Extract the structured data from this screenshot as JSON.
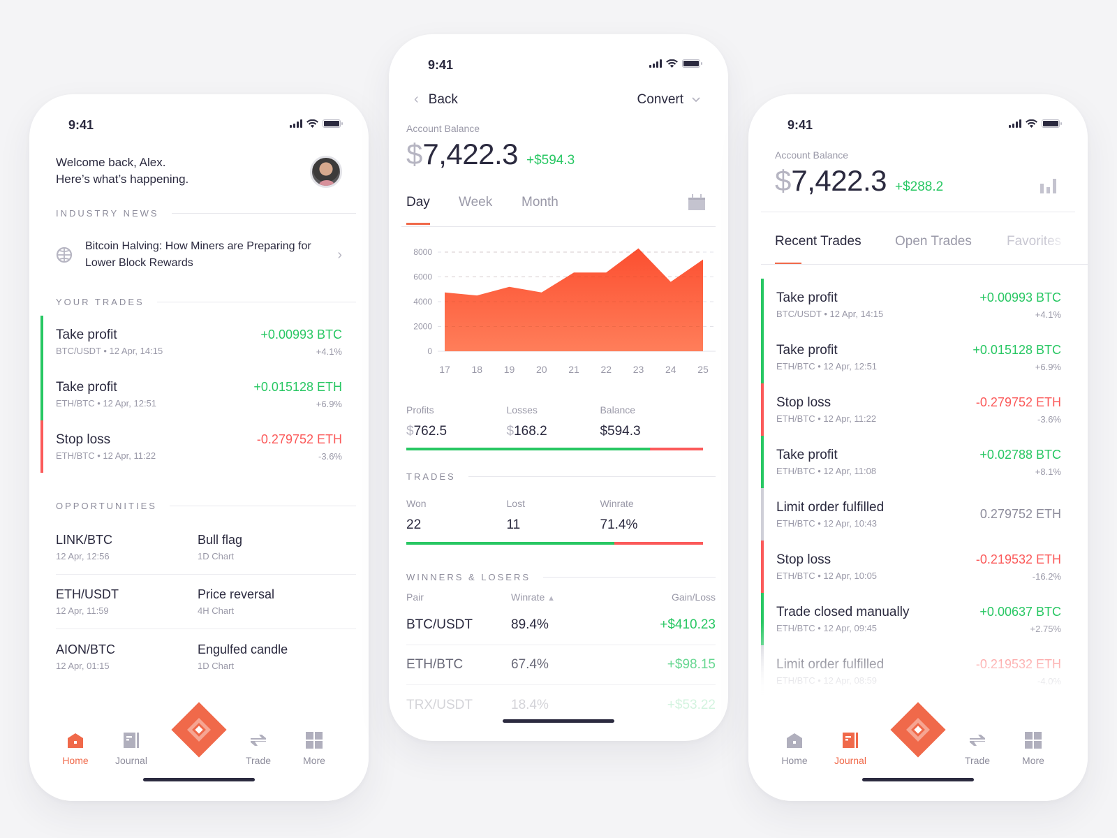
{
  "colors": {
    "accent": "#f0694a",
    "green": "#28c763",
    "red": "#fb5a5a",
    "neutral": "#cfcfd8",
    "text": "#2b2a3f",
    "muted": "#9a99a8"
  },
  "status_bar": {
    "time": "9:41"
  },
  "home": {
    "greeting_line1": "Welcome back, Alex.",
    "greeting_line2": "Here’s what’s happening.",
    "avatar_icon": "user-avatar",
    "industry_news_label": "INDUSTRY NEWS",
    "news": {
      "icon": "globe-icon",
      "title": "Bitcoin Halving: How Miners are Preparing for Lower Block Rewards"
    },
    "your_trades_label": "YOUR TRADES",
    "trades": [
      {
        "title": "Take profit",
        "pair": "BTC/USDT",
        "time": "12 Apr, 14:15",
        "amount": "+0.00993 BTC",
        "pct": "+4.1%",
        "status": "gain"
      },
      {
        "title": "Take profit",
        "pair": "ETH/BTC",
        "time": "12 Apr, 12:51",
        "amount": "+0.015128 ETH",
        "pct": "+6.9%",
        "status": "gain"
      },
      {
        "title": "Stop loss",
        "pair": "ETH/BTC",
        "time": "12 Apr, 11:22",
        "amount": "-0.279752 ETH",
        "pct": "-3.6%",
        "status": "loss"
      }
    ],
    "opportunities_label": "OPPORTUNITIES",
    "opportunities": [
      {
        "pair": "LINK/BTC",
        "time": "12 Apr, 12:56",
        "pattern": "Bull flag",
        "chart": "1D Chart"
      },
      {
        "pair": "ETH/USDT",
        "time": "12 Apr, 11:59",
        "pattern": "Price reversal",
        "chart": "4H Chart"
      },
      {
        "pair": "AION/BTC",
        "time": "12 Apr, 01:15",
        "pattern": "Engulfed candle",
        "chart": "1D Chart"
      }
    ]
  },
  "tabbar": {
    "items": [
      {
        "label": "Home",
        "icon": "home-icon"
      },
      {
        "label": "Journal",
        "icon": "journal-icon"
      },
      {
        "label": "",
        "icon": "logo-diamond-icon"
      },
      {
        "label": "Trade",
        "icon": "swap-arrows-icon"
      },
      {
        "label": "More",
        "icon": "grid-icon"
      }
    ]
  },
  "balance_screen": {
    "back_label": "Back",
    "convert_label": "Convert",
    "account_balance_label": "Account Balance",
    "currency_symbol": "$",
    "balance": "7,422.3",
    "change": "+$594.3",
    "periods": [
      "Day",
      "Week",
      "Month"
    ],
    "active_period": "Day",
    "stats": {
      "profits_label": "Profits",
      "profits": "762.5",
      "losses_label": "Losses",
      "losses": "168.2",
      "balance_label": "Balance",
      "balance": "$594.3",
      "profit_ratio": 0.82
    },
    "trades_label": "TRADES",
    "trades_stats": {
      "won_label": "Won",
      "won": "22",
      "lost_label": "Lost",
      "lost": "11",
      "winrate_label": "Winrate",
      "winrate": "71.4%",
      "won_ratio": 0.7
    },
    "winners_label": "WINNERS & LOSERS",
    "table_headers": {
      "pair": "Pair",
      "winrate": "Winrate",
      "gain": "Gain/Loss"
    },
    "table_rows": [
      {
        "pair": "BTC/USDT",
        "winrate": "89.4%",
        "gain": "+$410.23"
      },
      {
        "pair": "ETH/BTC",
        "winrate": "67.4%",
        "gain": "+$98.15"
      },
      {
        "pair": "TRX/USDT",
        "winrate": "18.4%",
        "gain": "+$53.22"
      }
    ]
  },
  "chart_data": {
    "type": "area",
    "title": "",
    "xlabel": "",
    "ylabel": "",
    "categories": [
      "17",
      "18",
      "19",
      "20",
      "21",
      "22",
      "23",
      "24",
      "25"
    ],
    "values": [
      4750,
      4500,
      5200,
      4750,
      6350,
      6350,
      8300,
      5600,
      7400
    ],
    "yticks": [
      0,
      2000,
      4000,
      6000,
      8000
    ],
    "ylim": [
      0,
      8000
    ],
    "grid": true,
    "legend": "none"
  },
  "journal_screen": {
    "account_balance_label": "Account Balance",
    "currency_symbol": "$",
    "balance": "7,422.3",
    "change": "+$288.2",
    "tabs": [
      "Recent Trades",
      "Open Trades",
      "Favorites"
    ],
    "active_tab": "Recent Trades",
    "trades": [
      {
        "title": "Take profit",
        "pair": "BTC/USDT",
        "time": "12 Apr, 14:15",
        "amount": "+0.00993 BTC",
        "pct": "+4.1%",
        "status": "gain"
      },
      {
        "title": "Take profit",
        "pair": "ETH/BTC",
        "time": "12 Apr, 12:51",
        "amount": "+0.015128 BTC",
        "pct": "+6.9%",
        "status": "gain"
      },
      {
        "title": "Stop loss",
        "pair": "ETH/BTC",
        "time": "12 Apr, 11:22",
        "amount": "-0.279752 ETH",
        "pct": "-3.6%",
        "status": "loss"
      },
      {
        "title": "Take profit",
        "pair": "ETH/BTC",
        "time": "12 Apr, 11:08",
        "amount": "+0.02788 BTC",
        "pct": "+8.1%",
        "status": "gain"
      },
      {
        "title": "Limit order fulfilled",
        "pair": "ETH/BTC",
        "time": "12 Apr, 10:43",
        "amount": "0.279752 ETH",
        "pct": "",
        "status": "neutral"
      },
      {
        "title": "Stop loss",
        "pair": "ETH/BTC",
        "time": "12 Apr, 10:05",
        "amount": "-0.219532 ETH",
        "pct": "-16.2%",
        "status": "loss"
      },
      {
        "title": "Trade closed manually",
        "pair": "ETH/BTC",
        "time": "12 Apr, 09:45",
        "amount": "+0.00637 BTC",
        "pct": "+2.75%",
        "status": "gain"
      },
      {
        "title": "Limit order fulfilled",
        "pair": "ETH/BTC",
        "time": "12 Apr, 08:59",
        "amount": "-0.219532 ETH",
        "pct": "-4.0%",
        "status": "loss-faded"
      }
    ]
  }
}
